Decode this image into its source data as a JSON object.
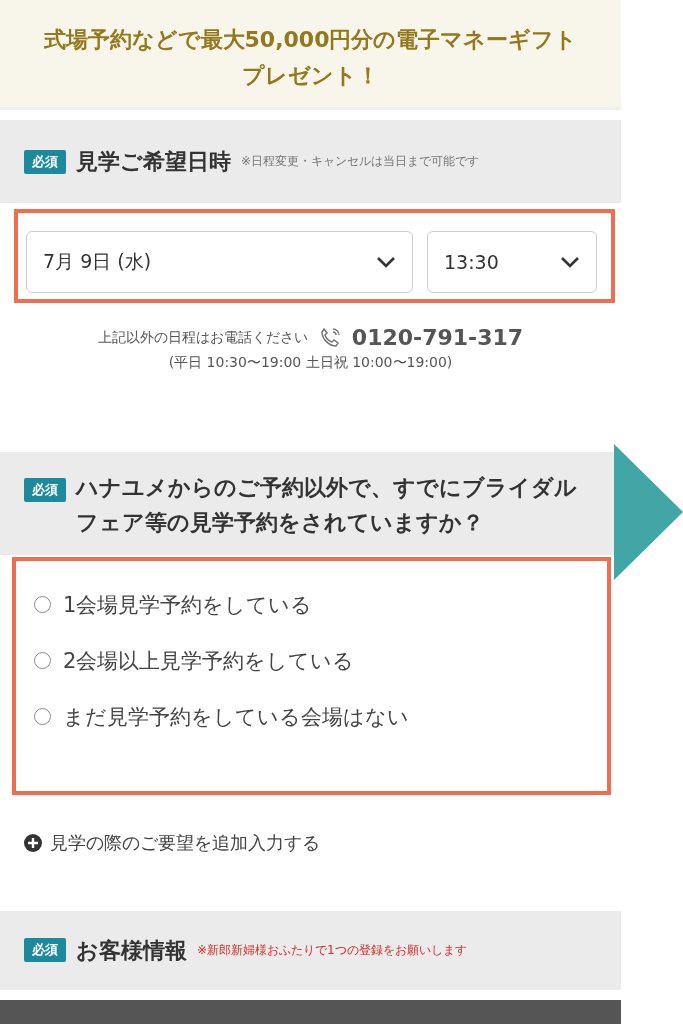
{
  "banner": {
    "text": "式場予約などで最大**50,000**円分の電子マネーギフトプレゼント！"
  },
  "visit_datetime": {
    "badge": "必須",
    "title": "見学ご希望日時",
    "note": {
      "text": "※日程変更・キャンセルは当日まで可能です",
      "color": "#777777"
    },
    "date_select": {
      "value": "7月 9日 (水)"
    },
    "time_select": {
      "value": "13:30"
    },
    "phone_lead": "上記以外の日程はお電話ください",
    "phone": "0120-791-317",
    "hours": "(平日 10:30〜19:00 土日祝 10:00〜19:00)"
  },
  "other_booking": {
    "badge": "必須",
    "title": "ハナユメからのご予約以外で、すでにブライダルフェア等の見学予約をされていますか？",
    "options": [
      {
        "label": "1会場見学予約をしている",
        "selected": false
      },
      {
        "label": "2会場以上見学予約をしている",
        "selected": false
      },
      {
        "label": "まだ見学予約をしている会場はない",
        "selected": false
      }
    ]
  },
  "add_request_link": "見学の際のご要望を追加入力する",
  "customer_info": {
    "badge": "必須",
    "title": "お客様情報",
    "note": {
      "text": "※新郎新婦様おふたりで1つの登録をお願いします",
      "color": "#d62b2b"
    }
  }
}
